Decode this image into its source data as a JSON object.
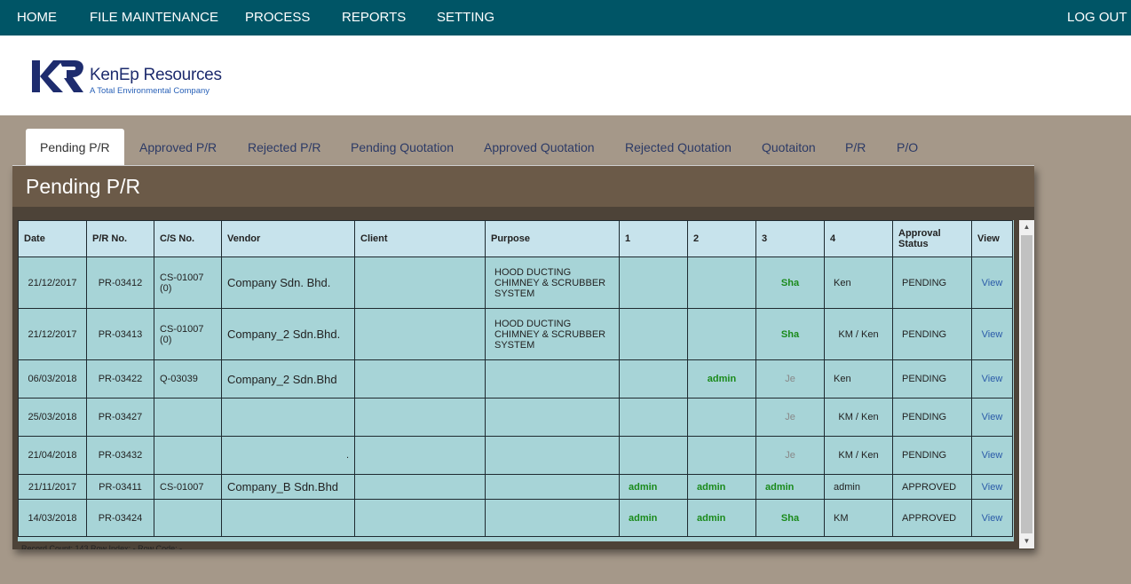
{
  "nav": {
    "home": "HOME",
    "file_maintenance": "FILE MAINTENANCE",
    "process": "PROCESS",
    "reports": "REPORTS",
    "setting": "SETTING",
    "logout": "LOG OUT"
  },
  "logo": {
    "mark": "KR",
    "brand": "KenEp Resources",
    "tagline": "A Total Environmental Company"
  },
  "tabs": [
    "Pending P/R",
    "Approved P/R",
    "Rejected P/R",
    "Pending Quotation",
    "Approved Quotation",
    "Rejected Quotation",
    "Quotaiton",
    "P/R",
    "P/O"
  ],
  "panel": {
    "title": "Pending P/R"
  },
  "table": {
    "headers": [
      "Date",
      "P/R No.",
      "C/S No.",
      "Vendor",
      "Client",
      "Purpose",
      "1",
      "2",
      "3",
      "4",
      "Approval Status",
      "View"
    ],
    "rows": [
      {
        "date": "21/12/2017",
        "pr": "PR-03412",
        "cs": "CS-01007 (0)",
        "vendor": "Company Sdn. Bhd.",
        "client": "",
        "purpose": "HOOD DUCTING CHIMNEY & SCRUBBER SYSTEM",
        "a1": "",
        "a2": "",
        "a3": "Sha",
        "a4": "Ken",
        "status": "PENDING",
        "view": "View"
      },
      {
        "date": "21/12/2017",
        "pr": "PR-03413",
        "cs": "CS-01007 (0)",
        "vendor": "Company_2 Sdn.Bhd.",
        "client": "",
        "purpose": "HOOD DUCTING CHIMNEY & SCRUBBER SYSTEM",
        "a1": "",
        "a2": "",
        "a3": "Sha",
        "a4": "KM / Ken",
        "status": "PENDING",
        "view": "View"
      },
      {
        "date": "06/03/2018",
        "pr": "PR-03422",
        "cs": "Q-03039",
        "vendor": "Company_2 Sdn.Bhd",
        "client": "",
        "purpose": "",
        "a1": "",
        "a2": "admin",
        "a3": "Je",
        "a4": "Ken",
        "status": "PENDING",
        "view": "View"
      },
      {
        "date": "25/03/2018",
        "pr": "PR-03427",
        "cs": "",
        "vendor": "",
        "client": "",
        "purpose": "",
        "a1": "",
        "a2": "",
        "a3": "Je",
        "a4": "KM / Ken",
        "status": "PENDING",
        "view": "View"
      },
      {
        "date": "21/04/2018",
        "pr": "PR-03432",
        "cs": "",
        "vendor": ".",
        "client": "",
        "purpose": "",
        "a1": "",
        "a2": "",
        "a3": "Je",
        "a4": "KM / Ken",
        "status": "PENDING",
        "view": "View"
      },
      {
        "date": "21/11/2017",
        "pr": "PR-03411",
        "cs": "CS-01007",
        "vendor": "Company_B Sdn.Bhd",
        "client": "",
        "purpose": "",
        "a1": "admin",
        "a2": "admin",
        "a3": "admin",
        "a4": "admin",
        "status": "APPROVED",
        "view": "View"
      },
      {
        "date": "14/03/2018",
        "pr": "PR-03424",
        "cs": "",
        "vendor": "",
        "client": "",
        "purpose": "",
        "a1": "admin",
        "a2": "admin",
        "a3": "Sha",
        "a4": "KM",
        "status": "APPROVED",
        "view": "View"
      }
    ]
  },
  "footer": {
    "text": "Record Count: 143 Row Index: - Row Code: -"
  },
  "colors": {
    "nav_bg": "#005566",
    "page_bg": "#a59889",
    "panel_bg": "#6b5a48",
    "table_cell": "#a7d4d7",
    "table_header": "#c7e3ec",
    "approved_green": "#1a8a1a"
  }
}
